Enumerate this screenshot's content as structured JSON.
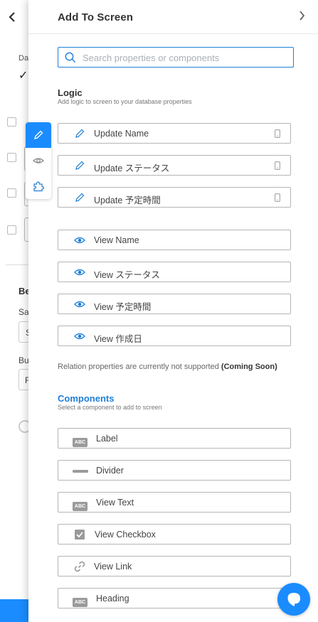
{
  "background": {
    "back_label": "‹",
    "da_label": "Da",
    "be_label": "Be",
    "sa_label": "Sa",
    "sa_value": "S",
    "bu_label": "Bu",
    "bu_value": "F"
  },
  "panel": {
    "title": "Add To Screen",
    "search": {
      "placeholder": "Search properties or components",
      "value": ""
    },
    "logic": {
      "title": "Logic",
      "subtitle": "Add logic to screen to your database properties",
      "update_items": [
        {
          "label": "Update Name"
        },
        {
          "label": "Update ステータス"
        },
        {
          "label": "Update 予定時間"
        }
      ],
      "view_items": [
        {
          "label": "View Name"
        },
        {
          "label": "View ステータス"
        },
        {
          "label": "View 予定時間"
        },
        {
          "label": "View 作成日"
        }
      ]
    },
    "note": {
      "text": "Relation properties are currently not supported",
      "bold": "(Coming Soon)"
    },
    "components": {
      "title": "Components",
      "subtitle": "Select a component to add to screen",
      "abc_text": "ABC",
      "items": [
        {
          "label": "Label",
          "icon": "abc-icon"
        },
        {
          "label": "Divider",
          "icon": "divider-icon"
        },
        {
          "label": "View Text",
          "icon": "abc-icon"
        },
        {
          "label": "View Checkbox",
          "icon": "checkbox-icon"
        },
        {
          "label": "View Link",
          "icon": "link-icon"
        },
        {
          "label": "Heading",
          "icon": "abc-icon"
        }
      ]
    }
  },
  "colors": {
    "accent": "#1a8cff",
    "border": "#b5b5b5",
    "icon_blue": "#1f7fd6"
  }
}
